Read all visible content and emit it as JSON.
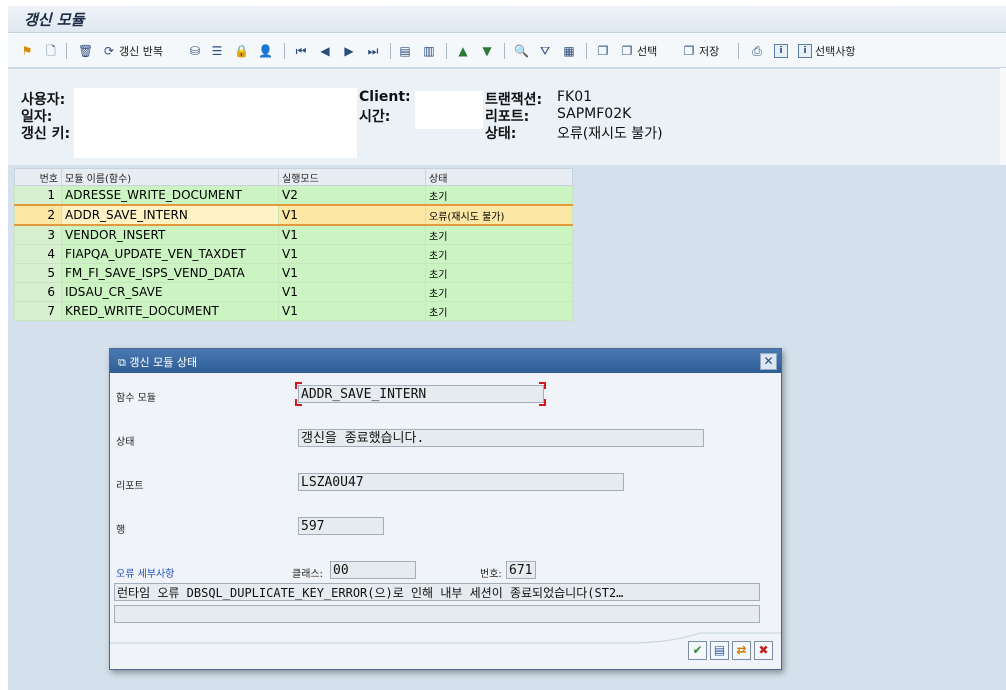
{
  "window": {
    "title": "갱신 모듈"
  },
  "toolbar": {
    "repeat_label": "갱신 반복",
    "select_label": "선택",
    "save_label": "저장",
    "selection_label": "선택사항"
  },
  "header": {
    "user_label": "사용자:",
    "date_label": "일자:",
    "key_label": "갱신 키:",
    "client_label": "Client:",
    "time_label": "시간:",
    "transaction_label": "트랜잭션:",
    "transaction_value": "FK01",
    "report_label": "리포트:",
    "report_value": "SAPMF02K",
    "status_label": "상태:",
    "status_value": "오류(재시도 불가)"
  },
  "grid": {
    "columns": [
      "번호",
      "모듈 이름(함수)",
      "실행모드",
      "상태"
    ],
    "rows": [
      {
        "no": "1",
        "module": "ADRESSE_WRITE_DOCUMENT",
        "mode": "V2",
        "status": "초기"
      },
      {
        "no": "2",
        "module": "ADDR_SAVE_INTERN",
        "mode": "V1",
        "status": "오류(재시도 불가)"
      },
      {
        "no": "3",
        "module": "VENDOR_INSERT",
        "mode": "V1",
        "status": "초기"
      },
      {
        "no": "4",
        "module": "FIAPQA_UPDATE_VEN_TAXDET",
        "mode": "V1",
        "status": "초기"
      },
      {
        "no": "5",
        "module": "FM_FI_SAVE_ISPS_VEND_DATA",
        "mode": "V1",
        "status": "초기"
      },
      {
        "no": "6",
        "module": "IDSAU_CR_SAVE",
        "mode": "V1",
        "status": "초기"
      },
      {
        "no": "7",
        "module": "KRED_WRITE_DOCUMENT",
        "mode": "V1",
        "status": "초기"
      }
    ],
    "selected_row": 2
  },
  "dialog": {
    "title": "갱신 모듈 상태",
    "function_module_label": "함수 모듈",
    "function_module_value": "ADDR_SAVE_INTERN",
    "status_label": "상태",
    "status_value": "갱신을 종료했습니다.",
    "report_label": "리포트",
    "report_value": "LSZA0U47",
    "row_label": "행",
    "row_value": "597",
    "error_details_label": "오류 세부사항",
    "class_label": "클래스:",
    "class_value": "00",
    "number_label": "번호:",
    "number_value": "671",
    "message": "런타임 오류 DBSQL_DUPLICATE_KEY_ERROR(으)로 인해 내부 세션이 종료되었습니다(ST2…",
    "message2": ""
  },
  "colors": {
    "row_green": "#ccf4c3",
    "row_selected": "#fde7a4",
    "dialog_title": "#2f5d96",
    "error_label": "#1f4fbf"
  }
}
